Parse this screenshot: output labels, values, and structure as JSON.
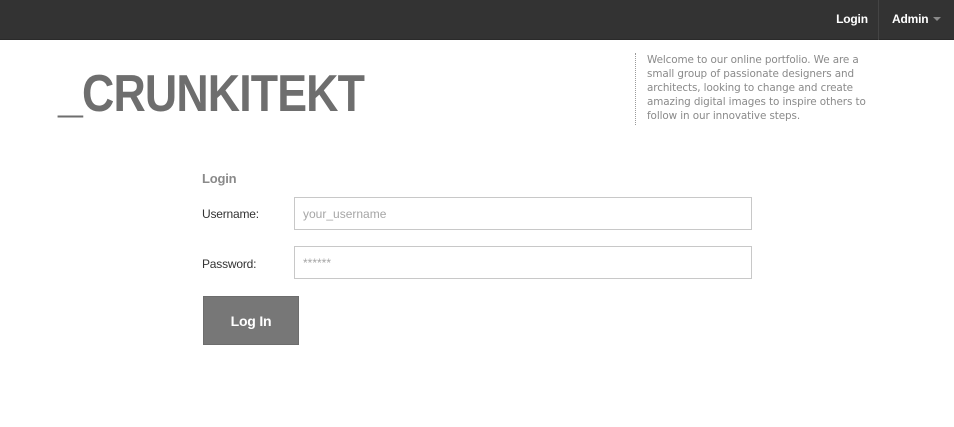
{
  "topbar": {
    "login_label": "Login",
    "admin_label": "Admin"
  },
  "header": {
    "logo_text": "_CRUNKITEKT",
    "welcome_text": "Welcome to our online portfolio. We are a small group of passionate designers and architects, looking to change and create amazing digital images to inspire others to follow in our innovative steps."
  },
  "login_form": {
    "title": "Login",
    "username_label": "Username:",
    "username_placeholder": "your_username",
    "username_value": "",
    "password_label": "Password:",
    "password_placeholder": "******",
    "password_value": "",
    "submit_label": "Log In"
  },
  "colors": {
    "topbar_bg": "#333333",
    "logo": "#6e6e6e",
    "button_bg": "#777777",
    "muted_text": "#8a8a8a"
  }
}
